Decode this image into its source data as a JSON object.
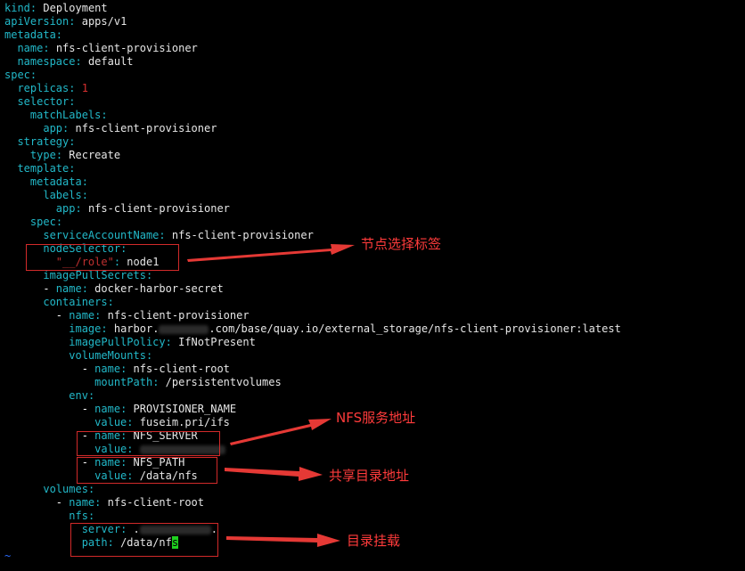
{
  "lines": [
    {
      "indent": 0,
      "key": "kind",
      "value": "Deployment"
    },
    {
      "indent": 0,
      "key": "apiVersion",
      "value": "apps/v1"
    },
    {
      "indent": 0,
      "key": "metadata",
      "value": ""
    },
    {
      "indent": 2,
      "key": "name",
      "value": "nfs-client-provisioner"
    },
    {
      "indent": 2,
      "key": "namespace",
      "value": "default"
    },
    {
      "indent": 0,
      "key": "spec",
      "value": ""
    },
    {
      "indent": 2,
      "key": "replicas",
      "value": "1",
      "num": true
    },
    {
      "indent": 2,
      "key": "selector",
      "value": ""
    },
    {
      "indent": 4,
      "key": "matchLabels",
      "value": ""
    },
    {
      "indent": 6,
      "key": "app",
      "value": "nfs-client-provisioner"
    },
    {
      "indent": 2,
      "key": "strategy",
      "value": ""
    },
    {
      "indent": 4,
      "key": "type",
      "value": "Recreate"
    },
    {
      "indent": 2,
      "key": "template",
      "value": ""
    },
    {
      "indent": 4,
      "key": "metadata",
      "value": ""
    },
    {
      "indent": 6,
      "key": "labels",
      "value": ""
    },
    {
      "indent": 8,
      "key": "app",
      "value": "nfs-client-provisioner"
    },
    {
      "indent": 4,
      "key": "spec",
      "value": ""
    },
    {
      "indent": 6,
      "key": "serviceAccountName",
      "value": "nfs-client-provisioner"
    },
    {
      "indent": 6,
      "key": "nodeSelector",
      "value": ""
    },
    {
      "indent": 8,
      "key": "\"__/role\"",
      "value": "node1",
      "quotedKey": true
    },
    {
      "indent": 6,
      "key": "imagePullSecrets",
      "value": ""
    },
    {
      "indent": 6,
      "dash": true,
      "key": "name",
      "value": "docker-harbor-secret"
    },
    {
      "indent": 6,
      "key": "containers",
      "value": ""
    },
    {
      "indent": 8,
      "dash": true,
      "key": "name",
      "value": "nfs-client-provisioner"
    },
    {
      "indent": 10,
      "key": "image",
      "value": "harbor.",
      "redactWidth": 56,
      "valueAfter": ".com/base/quay.io/external_storage/nfs-client-provisioner:latest"
    },
    {
      "indent": 10,
      "key": "imagePullPolicy",
      "value": "IfNotPresent"
    },
    {
      "indent": 10,
      "key": "volumeMounts",
      "value": ""
    },
    {
      "indent": 12,
      "dash": true,
      "key": "name",
      "value": "nfs-client-root"
    },
    {
      "indent": 14,
      "key": "mountPath",
      "value": "/persistentvolumes"
    },
    {
      "indent": 10,
      "key": "env",
      "value": ""
    },
    {
      "indent": 12,
      "dash": true,
      "key": "name",
      "value": "PROVISIONER_NAME"
    },
    {
      "indent": 14,
      "key": "value",
      "value": "fuseim.pri/ifs"
    },
    {
      "indent": 12,
      "dash": true,
      "key": "name",
      "value": "NFS_SERVER"
    },
    {
      "indent": 14,
      "key": "value",
      "value": "",
      "redactWidth": 96
    },
    {
      "indent": 12,
      "dash": true,
      "key": "name",
      "value": "NFS_PATH"
    },
    {
      "indent": 14,
      "key": "value",
      "value": "/data/nfs"
    },
    {
      "indent": 6,
      "key": "volumes",
      "value": ""
    },
    {
      "indent": 8,
      "dash": true,
      "key": "name",
      "value": "nfs-client-root"
    },
    {
      "indent": 10,
      "key": "nfs",
      "value": ""
    },
    {
      "indent": 12,
      "key": "server",
      "value": ".",
      "redactWidth": 80,
      "valueAfter": "."
    },
    {
      "indent": 12,
      "key": "path",
      "value": "/data/nf",
      "cursorChar": "s"
    }
  ],
  "tilde": "~",
  "annotations": [
    {
      "text": "节点选择标签"
    },
    {
      "text": "NFS服务地址"
    },
    {
      "text": "共享目录地址"
    },
    {
      "text": "目录挂载"
    }
  ],
  "colors": {
    "key": "#22b8c8",
    "value": "#e6e6e6",
    "number": "#d83030",
    "annotation": "#ff3b3b",
    "box": "#d22a2a",
    "cursor": "#1fd11f"
  }
}
